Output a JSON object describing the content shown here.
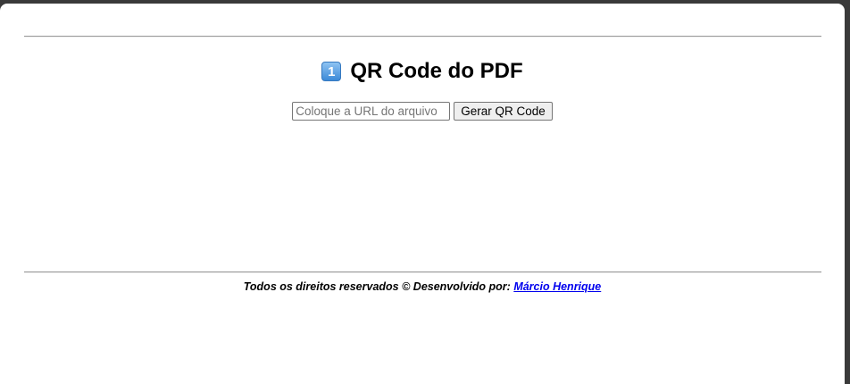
{
  "header": {
    "step_badge": "1",
    "title": "QR Code do PDF"
  },
  "form": {
    "url_placeholder": "Coloque a URL do arquivo",
    "url_value": "",
    "generate_label": "Gerar QR Code"
  },
  "footer": {
    "text": "Todos os direitos reservados © Desenvolvido por: ",
    "author_link": "Márcio Henrique"
  },
  "colors": {
    "link": "#0000ee",
    "badge": "#3d8ad8"
  }
}
